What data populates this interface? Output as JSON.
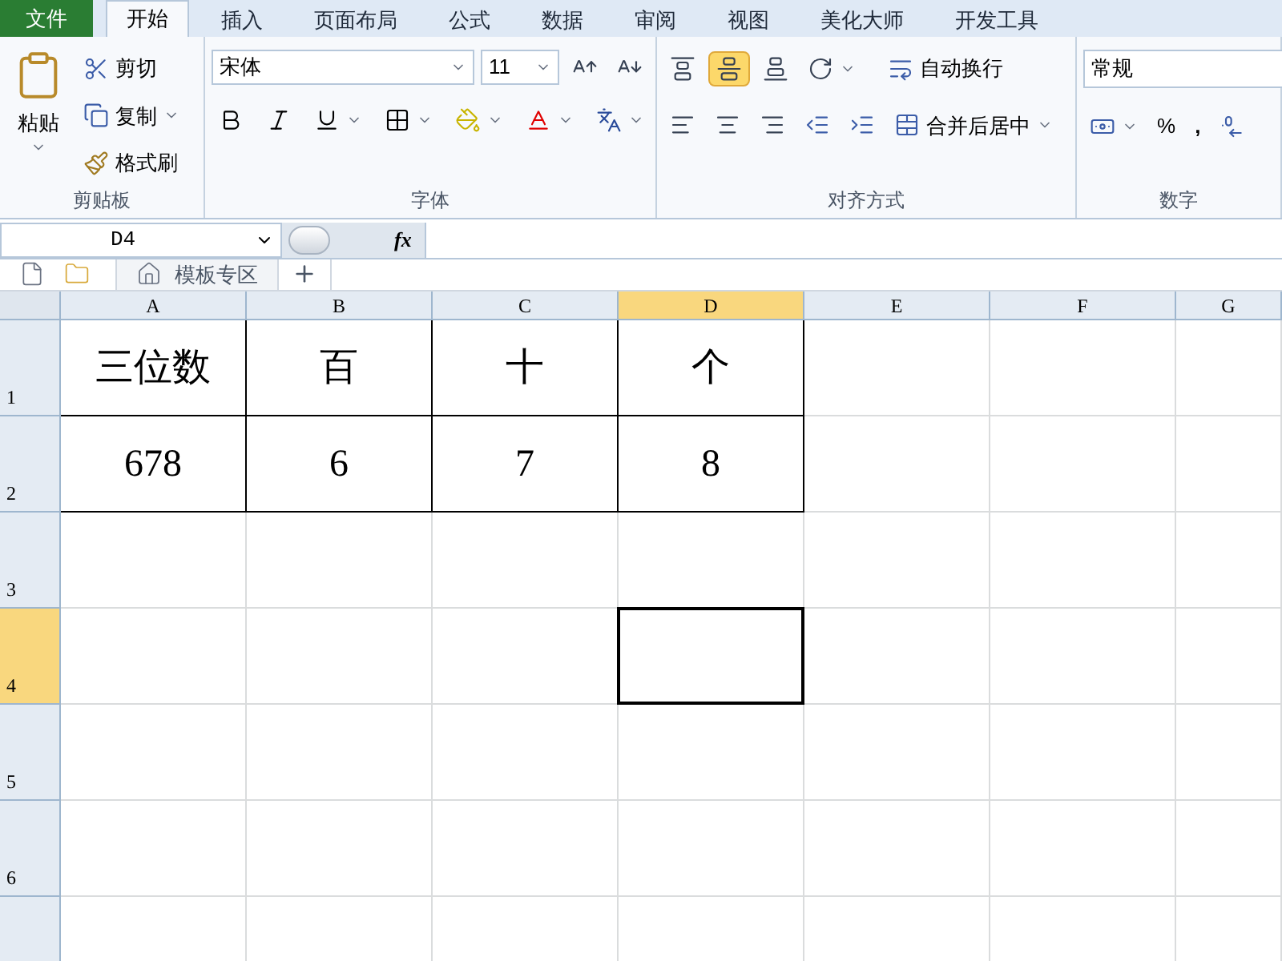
{
  "ribbon_tabs": [
    {
      "label": "文件",
      "kind": "file",
      "selected": false
    },
    {
      "label": "开始",
      "kind": "tab",
      "selected": true
    },
    {
      "label": "插入",
      "kind": "tab",
      "selected": false
    },
    {
      "label": "页面布局",
      "kind": "tab",
      "selected": false
    },
    {
      "label": "公式",
      "kind": "tab",
      "selected": false
    },
    {
      "label": "数据",
      "kind": "tab",
      "selected": false
    },
    {
      "label": "审阅",
      "kind": "tab",
      "selected": false
    },
    {
      "label": "视图",
      "kind": "tab",
      "selected": false
    },
    {
      "label": "美化大师",
      "kind": "tab",
      "selected": false
    },
    {
      "label": "开发工具",
      "kind": "tab",
      "selected": false
    }
  ],
  "clipboard": {
    "label": "剪贴板",
    "paste": "粘贴",
    "cut": "剪切",
    "copy": "复制",
    "format_painter": "格式刷"
  },
  "font": {
    "label": "字体",
    "font_name": "宋体",
    "font_size": "11"
  },
  "alignment": {
    "label": "对齐方式",
    "wrap_text": "自动换行",
    "merge_center": "合并后居中",
    "middle_align_selected": true
  },
  "number": {
    "label": "数字",
    "format": "常规",
    "percent": "%",
    "comma": ","
  },
  "formula_bar": {
    "name_box": "D4",
    "fx": "fx"
  },
  "sheet_tabs": [
    {
      "label": "模板专区"
    }
  ],
  "columns": [
    {
      "label": "A",
      "selected": false
    },
    {
      "label": "B",
      "selected": false
    },
    {
      "label": "C",
      "selected": false
    },
    {
      "label": "D",
      "selected": true
    },
    {
      "label": "E",
      "selected": false
    },
    {
      "label": "F",
      "selected": false
    },
    {
      "label": "G",
      "selected": false
    }
  ],
  "rows": [
    {
      "label": "1",
      "selected": false,
      "cells": [
        "三位数",
        "百",
        "十",
        "个"
      ]
    },
    {
      "label": "2",
      "selected": false,
      "cells": [
        "678",
        "6",
        "7",
        "8"
      ]
    },
    {
      "label": "3",
      "selected": false,
      "cells": []
    },
    {
      "label": "4",
      "selected": true,
      "cells": []
    },
    {
      "label": "5",
      "selected": false,
      "cells": []
    },
    {
      "label": "6",
      "selected": false,
      "cells": []
    }
  ]
}
